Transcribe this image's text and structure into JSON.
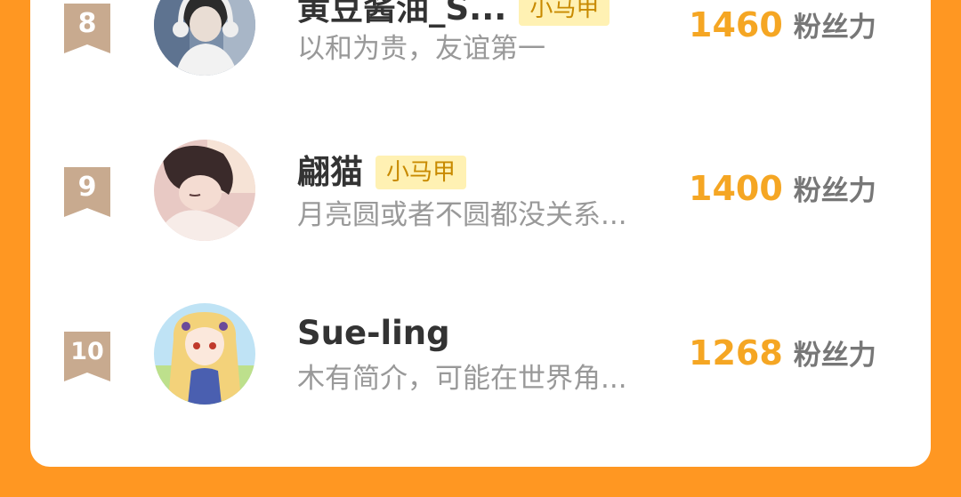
{
  "colors": {
    "page_background": "#ff9722",
    "card_background": "#ffffff",
    "rank_badge": "#c8aa8f",
    "score": "#f5a623",
    "tag_background": "#fff1b3",
    "tag_text": "#c88a00",
    "name": "#333333",
    "bio": "#999999"
  },
  "rankings": [
    {
      "rank": "8",
      "name": "黄豆酱油_S...",
      "tag": "小马甲",
      "bio": "以和为贵，友谊第一",
      "score": "1460",
      "unit": "粉丝力",
      "avatar_icon": "avatar-boy-headphones-icon"
    },
    {
      "rank": "9",
      "name": "翩猫",
      "tag": "小马甲",
      "bio": "月亮圆或者不圆都没关系...",
      "score": "1400",
      "unit": "粉丝力",
      "avatar_icon": "avatar-anime-boy-icon"
    },
    {
      "rank": "10",
      "name": "Sue-ling",
      "tag": "",
      "bio": "木有简介，可能在世界角...",
      "score": "1268",
      "unit": "粉丝力",
      "avatar_icon": "avatar-anime-girl-icon"
    }
  ]
}
